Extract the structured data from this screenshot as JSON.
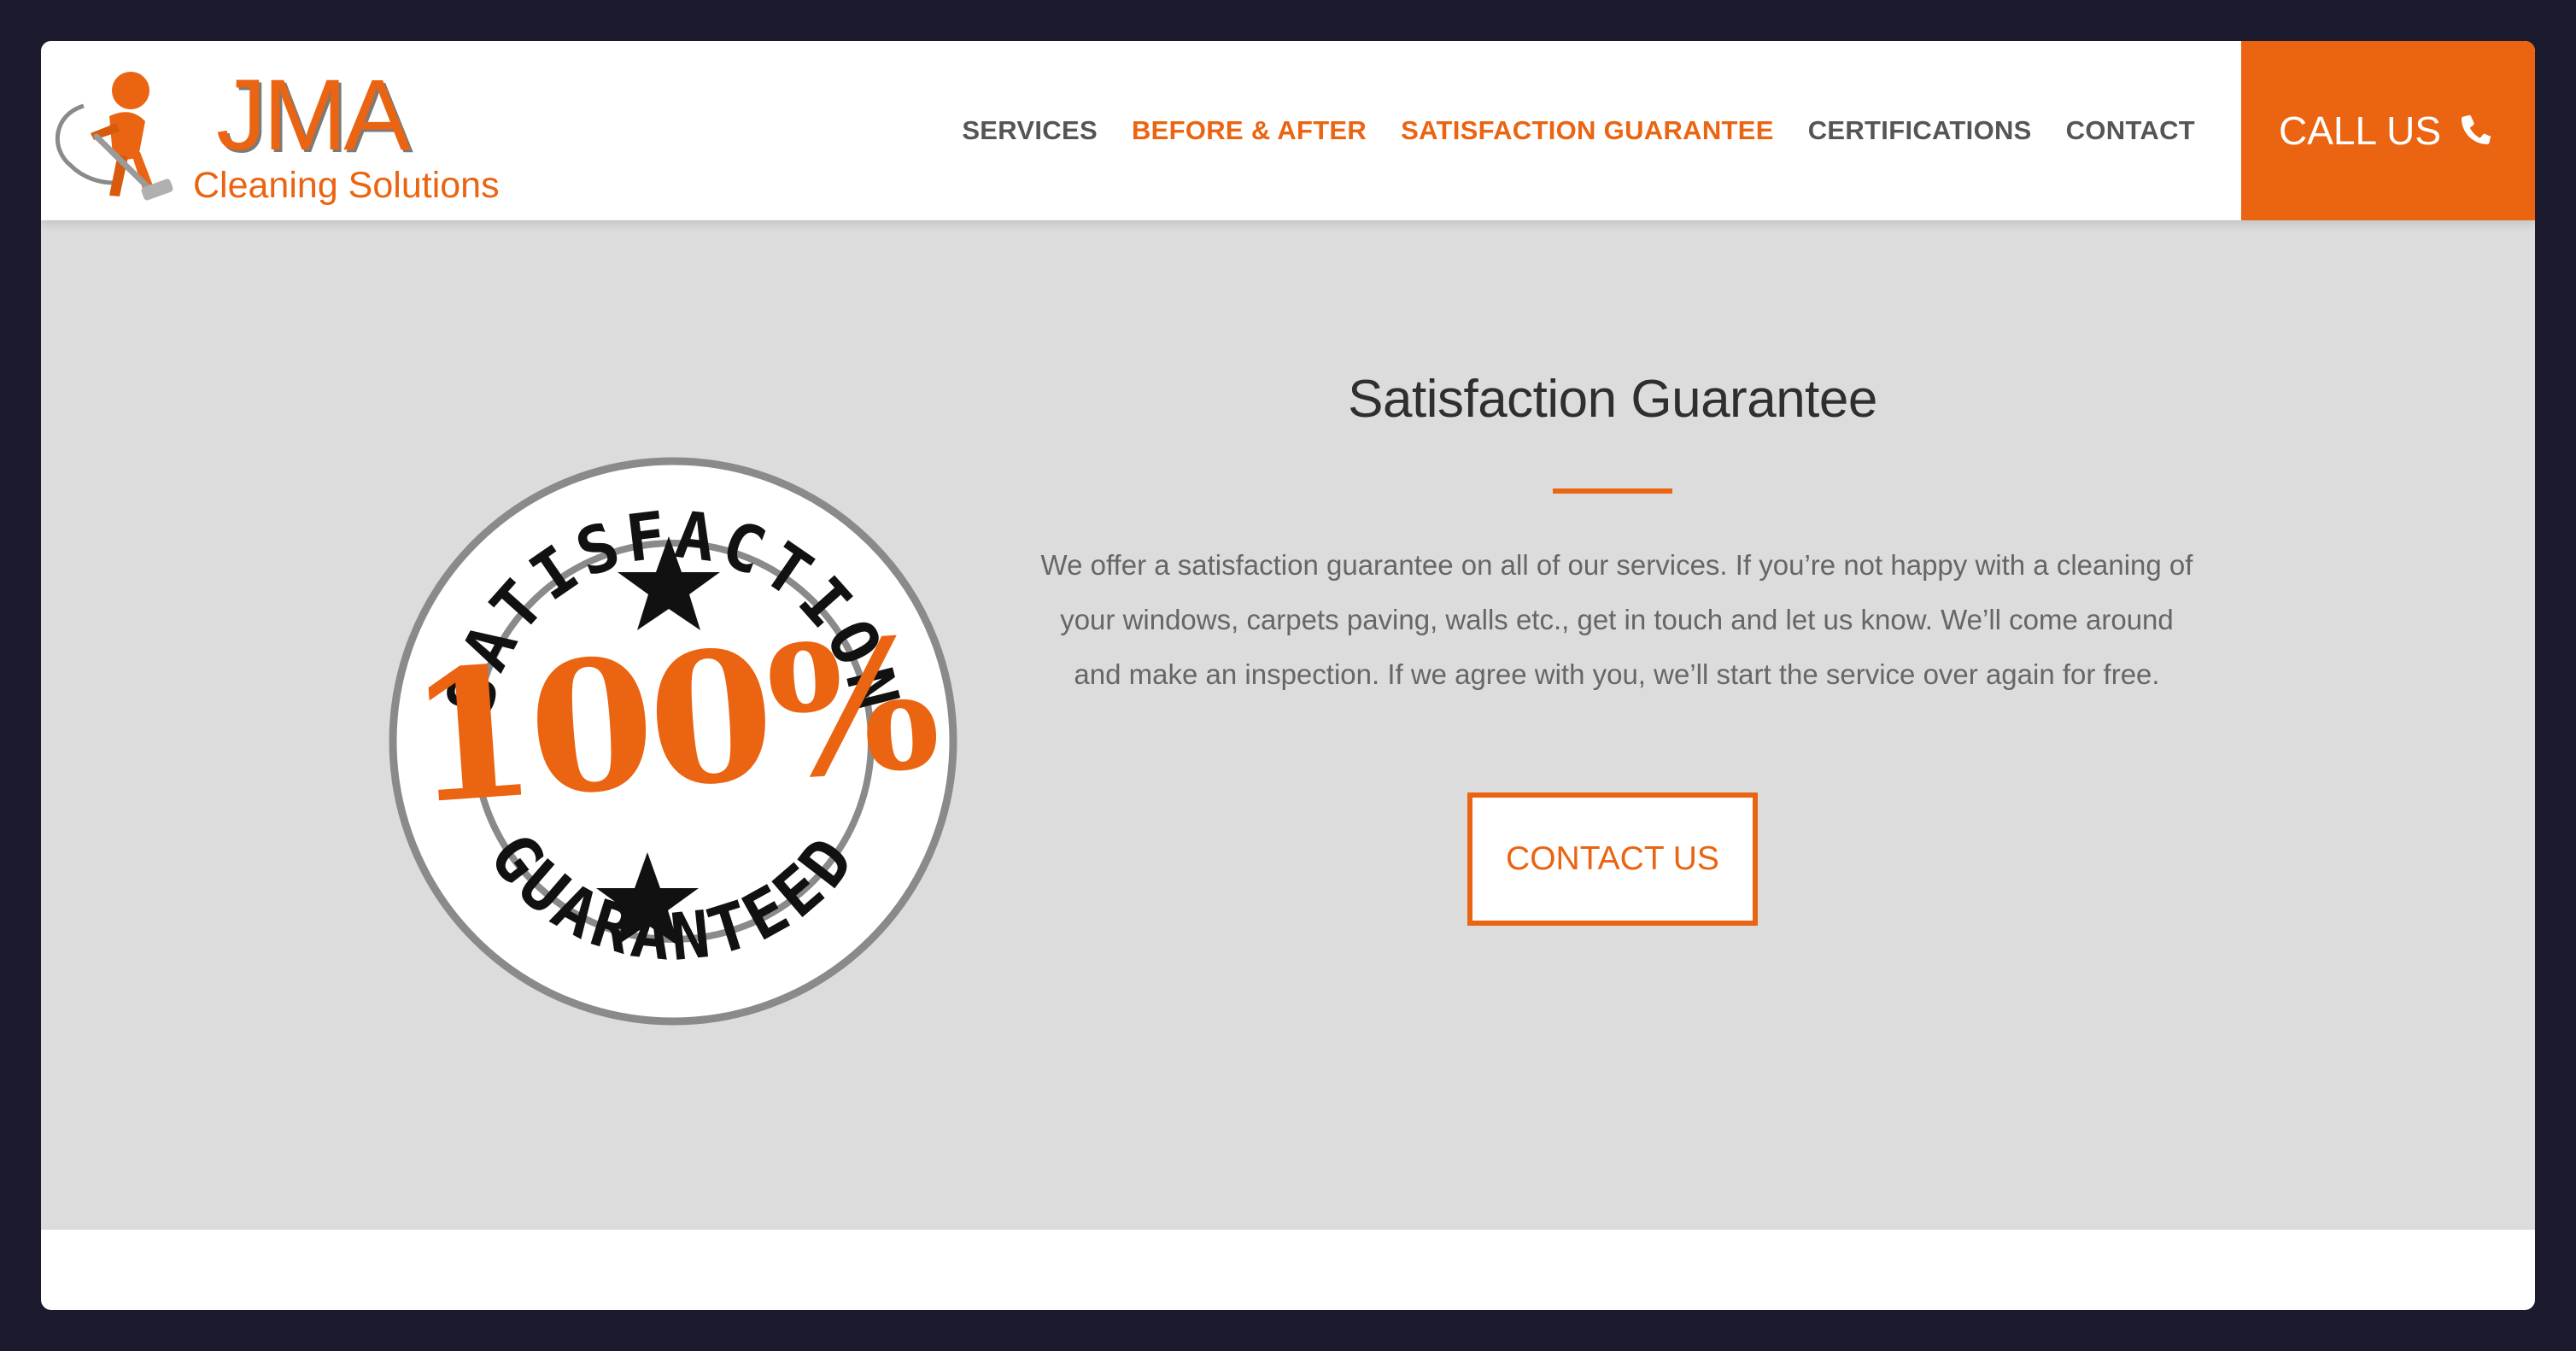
{
  "brand": {
    "name": "JMA",
    "tagline": "Cleaning Solutions",
    "accent_color": "#ea6411",
    "mascot_icon": "cleaning-mascot-icon"
  },
  "nav": {
    "items": [
      {
        "label": "SERVICES",
        "active": false
      },
      {
        "label": "BEFORE & AFTER",
        "active": true
      },
      {
        "label": "SATISFACTION GUARANTEE",
        "active": true
      },
      {
        "label": "CERTIFICATIONS",
        "active": false
      },
      {
        "label": "CONTACT",
        "active": false
      }
    ],
    "call_label": "CALL US",
    "call_icon": "phone-icon"
  },
  "hero": {
    "title": "Satisfaction Guarantee",
    "description": "We offer a satisfaction guarantee on all of our services. If you’re not happy with a cleaning of\nyour windows, carpets paving, walls etc., get in touch and let us know. We’ll come around\nand make an inspection. If we agree with you, we’ll start the service over again for free.",
    "cta_label": "CONTACT US",
    "background_color": "#dcdcdc"
  },
  "badge": {
    "top_text": "SATISFACTION",
    "percent": "100%",
    "bottom_text": "GUARANTEED",
    "icon": "guarantee-stamp-icon"
  }
}
